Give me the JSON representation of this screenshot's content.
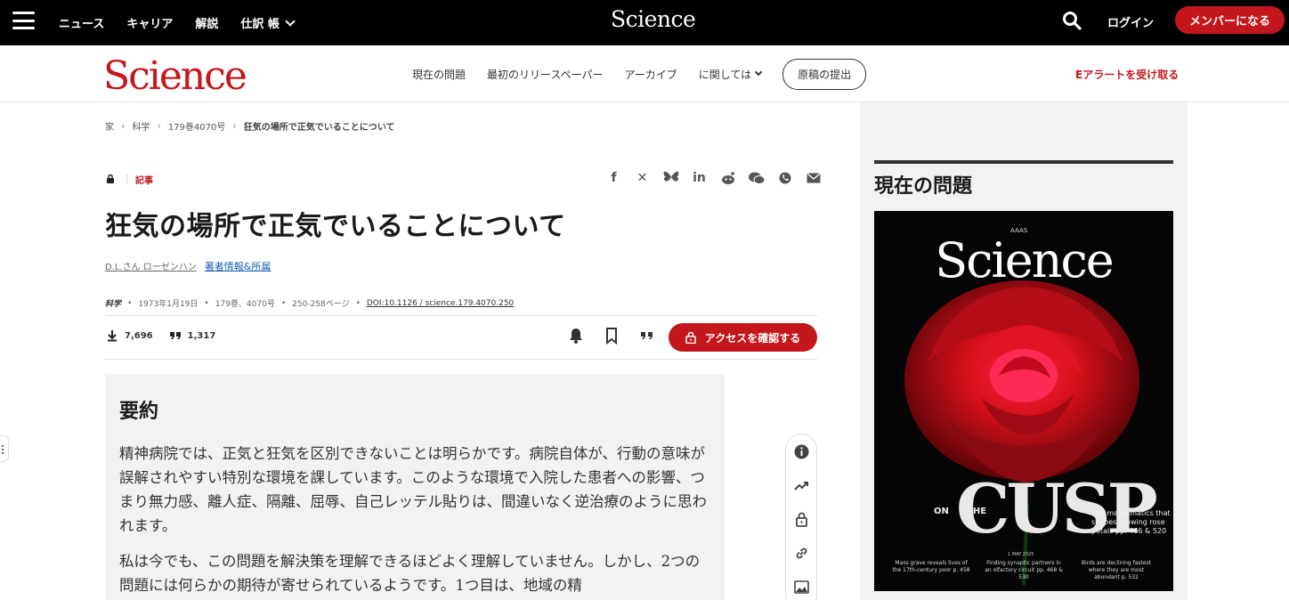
{
  "topbar": {
    "nav": [
      "ニュース",
      "キャリア",
      "解説",
      "仕訳 帳"
    ],
    "logo": "Science",
    "login": "ログイン",
    "member": "メンバーになる"
  },
  "header": {
    "logo": "Science",
    "nav": [
      "現在の問題",
      "最初のリリースペーパー",
      "アーカイブ",
      "に関しては"
    ],
    "submit": "原稿の提出",
    "ealert": "Eアラートを受け取る"
  },
  "breadcrumb": [
    "家",
    "科学",
    "179巻4070号",
    "狂気の場所で正気でいることについて"
  ],
  "article": {
    "type": "記事",
    "title": "狂気の場所で正気でいることについて",
    "author": "D.L.さん ローゼンハン",
    "author_info": "著者情報&所属",
    "journal": "科学",
    "date": "1973年1月19日",
    "volume": "179巻、4070号",
    "pages": "250-258ページ",
    "doi": "DOI:10.1126 / science.179.4070.250",
    "downloads": "7,696",
    "citations": "1,317",
    "access": "アクセスを確認する"
  },
  "abstract": {
    "heading": "要約",
    "p1": "精神病院では、正気と狂気を区別できないことは明らかです。病院自体が、行動の意味が誤解されやすい特別な環境を課しています。このような環境で入院した患者への影響、つまり無力感、離人症、隔離、屈辱、自己レッテル貼りは、間違いなく逆治療のように思われます。",
    "p2": "私は今でも、この問題を解決策を理解できるほどよく理解していません。しかし、2つの問題には何らかの期待が寄せられているようです。1つ目は、地域の精"
  },
  "sidebar": {
    "heading": "現在の問題",
    "cover": {
      "aaas": "AAAS",
      "logo": "Science",
      "on": "ON",
      "the": "THE",
      "cusp": "CUSP",
      "tagline": "The mathematics that shapes growing rose petals",
      "tag_pages": "pp. 466 & 520",
      "date": "1 MAY 2025",
      "teasers": [
        "Mass grave reveals lives of the 17th-century poor",
        "Finding synaptic partners in an olfactory circuit",
        "Birds are declining fastest where they are most abundant"
      ],
      "teaser_pages": [
        "p. 458",
        "pp. 468 & 530",
        "p. 532"
      ]
    }
  },
  "colors": {
    "brand_red": "#c4171d",
    "topbar": "#000000",
    "sidebar_bg": "#f2f2f2"
  }
}
